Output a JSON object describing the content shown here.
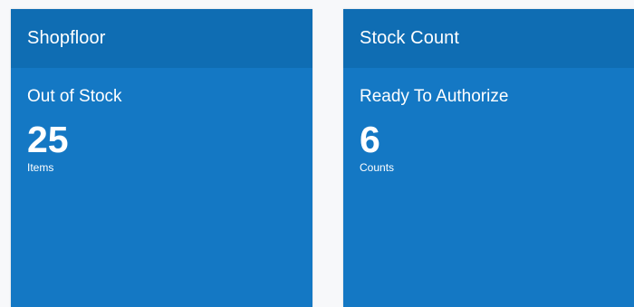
{
  "colors": {
    "page_background": "#f7f8fa",
    "tile_body": "#1478c4",
    "tile_header": "#0f6db3",
    "text": "#ffffff"
  },
  "tiles": [
    {
      "title": "Shopfloor",
      "subtitle": "Out of Stock",
      "value": "25",
      "unit": "Items"
    },
    {
      "title": "Stock Count",
      "subtitle": "Ready To Authorize",
      "value": "6",
      "unit": "Counts"
    }
  ]
}
